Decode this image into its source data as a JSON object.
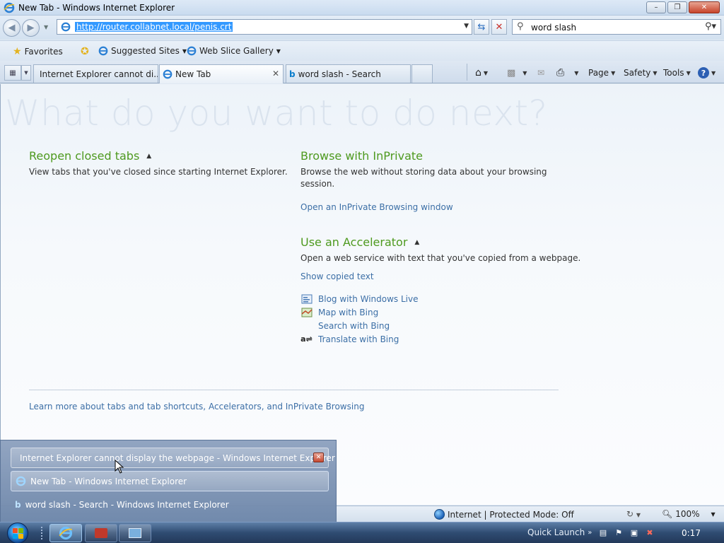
{
  "window": {
    "title": "New Tab - Windows Internet Explorer"
  },
  "address": {
    "url": "http://router.collabnet.local/penis.crt"
  },
  "search": {
    "query": "word slash"
  },
  "favorites_bar": {
    "favorites_label": "Favorites",
    "suggested_sites_label": "Suggested Sites",
    "web_slice_gallery_label": "Web Slice Gallery"
  },
  "tabs": [
    {
      "label": "Internet Explorer cannot di..."
    },
    {
      "label": "New Tab"
    },
    {
      "label": "word slash - Search"
    }
  ],
  "command_bar": {
    "page_label": "Page",
    "safety_label": "Safety",
    "tools_label": "Tools"
  },
  "newtab": {
    "heading": "What do you want to do next?",
    "reopen": {
      "title": "Reopen closed tabs",
      "desc": "View tabs that you've closed since starting Internet Explorer."
    },
    "inprivate": {
      "title": "Browse with InPrivate",
      "desc": "Browse the web without storing data about your browsing session.",
      "link": "Open an InPrivate Browsing window"
    },
    "accelerator": {
      "title": "Use an Accelerator",
      "desc": "Open a web service with text that you've copied from a webpage.",
      "show_copied": "Show copied text",
      "items": [
        {
          "label": "Blog with Windows Live"
        },
        {
          "label": "Map with Bing"
        },
        {
          "label": "Search with Bing"
        },
        {
          "label": "Translate with Bing"
        }
      ]
    },
    "learn_more": "Learn more about tabs and tab shortcuts, Accelerators, and InPrivate Browsing"
  },
  "statusbar": {
    "zone": "Internet | Protected Mode: Off",
    "zoom": "100%"
  },
  "taskbar_popup": [
    {
      "label": "Internet Explorer cannot display the webpage - Windows Internet Explorer"
    },
    {
      "label": "New Tab - Windows Internet Explorer"
    },
    {
      "label": "word slash - Search - Windows Internet Explorer"
    }
  ],
  "taskbar": {
    "quick_launch": "Quick Launch",
    "clock": "0:17"
  },
  "colors": {
    "section_green": "#4e9a1f",
    "link_blue": "#3c6fa6",
    "hero_gray": "#dae3ee"
  }
}
